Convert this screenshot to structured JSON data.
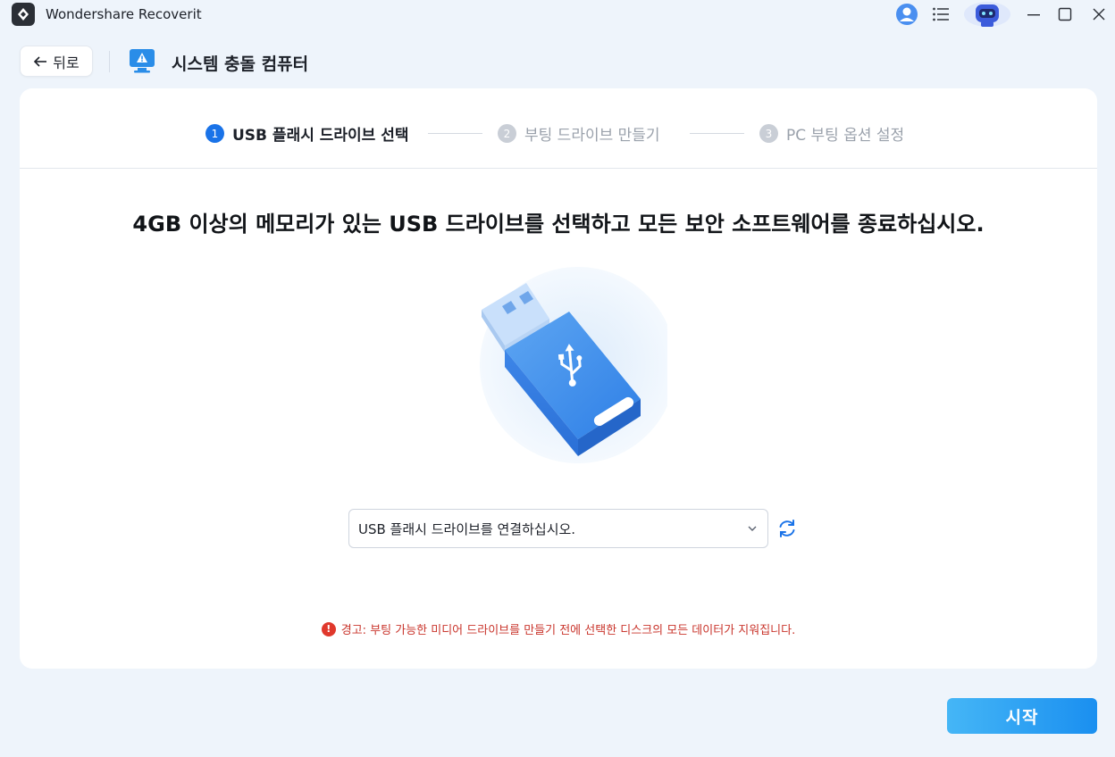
{
  "window": {
    "title": "Wondershare Recoverit",
    "icons": [
      "recoverit-logo-icon",
      "user-account-icon",
      "menu-list-icon",
      "ai-robot-icon",
      "minimize-icon",
      "maximize-icon",
      "close-icon"
    ]
  },
  "header": {
    "back_label": "뒤로",
    "title": "시스템 충돌 컴퓨터"
  },
  "steps": [
    {
      "number": "1",
      "label": "USB 플래시 드라이브 선택",
      "state": "active"
    },
    {
      "number": "2",
      "label": "부팅 드라이브 만들기",
      "state": "inactive"
    },
    {
      "number": "3",
      "label": "PC 부팅 옵션 설정",
      "state": "inactive"
    }
  ],
  "main": {
    "headline": "4GB 이상의 메모리가 있는 USB 드라이브를 선택하고 모든 보안 소프트웨어를 종료하십시오.",
    "select_placeholder": "USB 플래시 드라이브를 연결하십시오.",
    "warning_text": "경고: 부팅 가능한 미디어 드라이브를 만들기 전에 선택한 디스크의 모든 데이터가 지워집니다."
  },
  "footer": {
    "start_label": "시작"
  },
  "colors": {
    "accent": "#1a73e8",
    "start_button": "#2a9df4",
    "warning": "#c9352c",
    "background": "#eef4fb"
  }
}
